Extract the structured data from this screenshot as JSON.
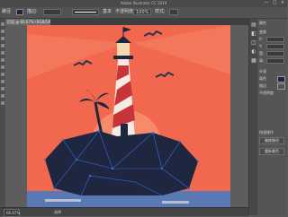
{
  "window": {
    "title": "Adobe Illustrator CC 2019",
    "controls": [
      "—",
      "□",
      "×"
    ]
  },
  "control_bar": {
    "fill_label": "路径",
    "stroke_label": "描边:",
    "style_label": "基本",
    "opacity_label": "不透明度:",
    "opacity_value": "100%",
    "style_field": "样式:"
  },
  "document_tab": {
    "label": "灯塔 @ 66.67% (RGB/GPU 预览)"
  },
  "status_bar": {
    "zoom": "66.67%",
    "tool": "选择"
  },
  "right_panel": {
    "labels": [
      "属性",
      "变换",
      "X:",
      "Y:",
      "宽:",
      "高:",
      "外观",
      "填色",
      "描边",
      "不透明度",
      "快速操作"
    ],
    "buttons": [
      "偏移路径",
      "重新着色"
    ]
  },
  "colors": {
    "sky": "#f1684f",
    "sun": "#f68a6a",
    "rock": "#1f2740",
    "lighthouse_red": "#c9343a",
    "water": "#5a78b4",
    "selection": "#2f6fe0"
  }
}
